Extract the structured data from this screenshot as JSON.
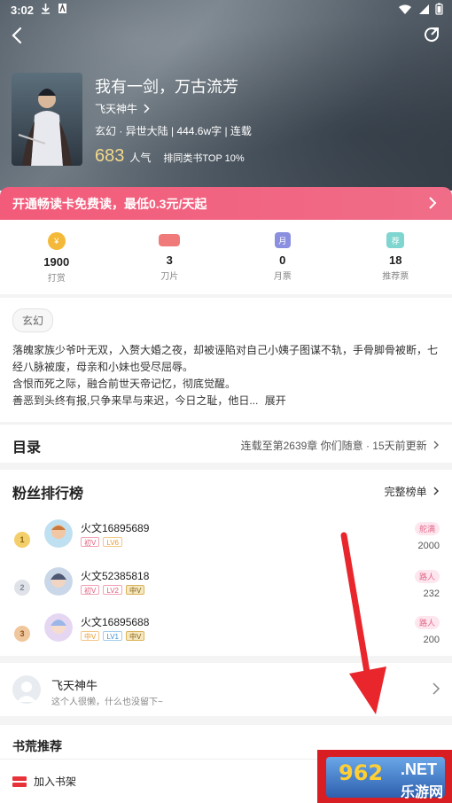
{
  "status_bar": {
    "time": "3:02"
  },
  "book": {
    "title": "我有一剑，万古流芳",
    "author": "飞天神牛",
    "meta": "玄幻 · 异世大陆 | 444.6w字 | 连载",
    "popularity": "683",
    "popularity_label": "人气",
    "rank_text": "排同类书TOP 10%"
  },
  "promo": {
    "text": "开通畅读卡免费读，最低0.3元/天起"
  },
  "stats": [
    {
      "value": "1900",
      "label": "打赏",
      "icon": "reward-icon",
      "color": "#f5b93a"
    },
    {
      "value": "3",
      "label": "刀片",
      "icon": "blade-icon",
      "color": "#f07a7a"
    },
    {
      "value": "0",
      "label": "月票",
      "icon": "monthly-ticket-icon",
      "color": "#8b8fe0"
    },
    {
      "value": "18",
      "label": "推荐票",
      "icon": "recommend-ticket-icon",
      "color": "#5ec8c0"
    }
  ],
  "description": {
    "genre_tag": "玄幻",
    "line1": "落魄家族少爷叶无双，入赘大婚之夜，却被诬陷对自己小姨子图谋不轨，手骨脚骨被断，七经八脉被废，母亲和小妹也受尽屈辱。",
    "line2": "含恨而死之际，融合前世天帝记忆，彻底觉醒。",
    "line3": "善恶到头终有报,只争来早与来迟，今日之耻，他日...",
    "expand": "展开"
  },
  "toc": {
    "title": "目录",
    "update": "连载至第2639章 你们随意 · 15天前更新"
  },
  "fans": {
    "title": "粉丝排行榜",
    "more": "完整榜单",
    "rows": [
      {
        "rank": "1",
        "name": "火文16895689",
        "title": "舵满",
        "score": "2000",
        "b1": "初V",
        "b2": "LV6",
        "b3": ""
      },
      {
        "rank": "2",
        "name": "火文52385818",
        "title": "路人",
        "score": "232",
        "b1": "初V",
        "b2": "LV2",
        "b3": "中V"
      },
      {
        "rank": "3",
        "name": "火文16895688",
        "title": "路人",
        "score": "200",
        "b1": "中V",
        "b2": "LV1",
        "b3": "中V"
      }
    ]
  },
  "author_card": {
    "name": "飞天神牛",
    "signature": "这个人很懒，什么也没留下~"
  },
  "recommend": {
    "title": "书荒推荐"
  },
  "bottom": {
    "add_shelf": "加入书架"
  },
  "watermark": {
    "num": "962",
    "net": ".NET",
    "site": "乐游网"
  }
}
